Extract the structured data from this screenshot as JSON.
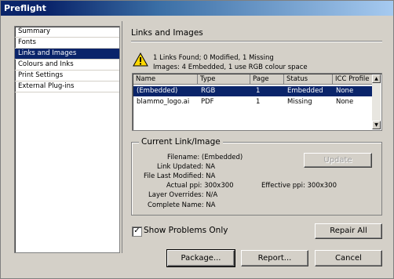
{
  "window": {
    "title": "Preflight"
  },
  "sidebar": {
    "items": [
      {
        "label": "Summary",
        "selected": false
      },
      {
        "label": "Fonts",
        "selected": false
      },
      {
        "label": "Links and Images",
        "selected": true
      },
      {
        "label": "Colours and Inks",
        "selected": false
      },
      {
        "label": "Print Settings",
        "selected": false
      },
      {
        "label": "External Plug-ins",
        "selected": false
      }
    ]
  },
  "main": {
    "section_title": "Links and Images",
    "warning_icon": "warning-triangle-icon",
    "summary_line1": "1 Links Found; 0 Modified, 1 Missing",
    "summary_line2": "Images: 4 Embedded, 1 use RGB colour space",
    "table": {
      "headers": [
        "Name",
        "Type",
        "Page",
        "Status",
        "ICC Profile"
      ],
      "rows": [
        {
          "name": "(Embedded)",
          "type": "RGB",
          "page": "1",
          "status": "Embedded",
          "icc": "None",
          "selected": true
        },
        {
          "name": "blammo_logo.ai",
          "type": "PDF",
          "page": "1",
          "status": "Missing",
          "icc": "None",
          "selected": false
        }
      ]
    },
    "current": {
      "group_title": "Current Link/Image",
      "filename_label": "Filename:",
      "filename_value": "(Embedded)",
      "link_updated_label": "Link Updated:",
      "link_updated_value": "NA",
      "file_last_modified_label": "File Last Modified:",
      "file_last_modified_value": "NA",
      "actual_ppi_label": "Actual ppi:",
      "actual_ppi_value": "300x300",
      "effective_ppi_label": "Effective ppi:",
      "effective_ppi_value": "300x300",
      "layer_overrides_label": "Layer Overrides:",
      "layer_overrides_value": "N/A",
      "complete_name_label": "Complete Name:",
      "complete_name_value": "NA",
      "update_button": "Update"
    },
    "show_problems_only": {
      "label": "Show Problems Only",
      "checked": true,
      "mark": "✓"
    },
    "repair_all_button": "Repair All"
  },
  "footer": {
    "package_button": "Package...",
    "report_button": "Report...",
    "cancel_button": "Cancel"
  },
  "colors": {
    "selection": "#0a246a",
    "title_gradient_start": "#0a246a",
    "title_gradient_end": "#a6caf0",
    "face": "#d4d0c8"
  }
}
